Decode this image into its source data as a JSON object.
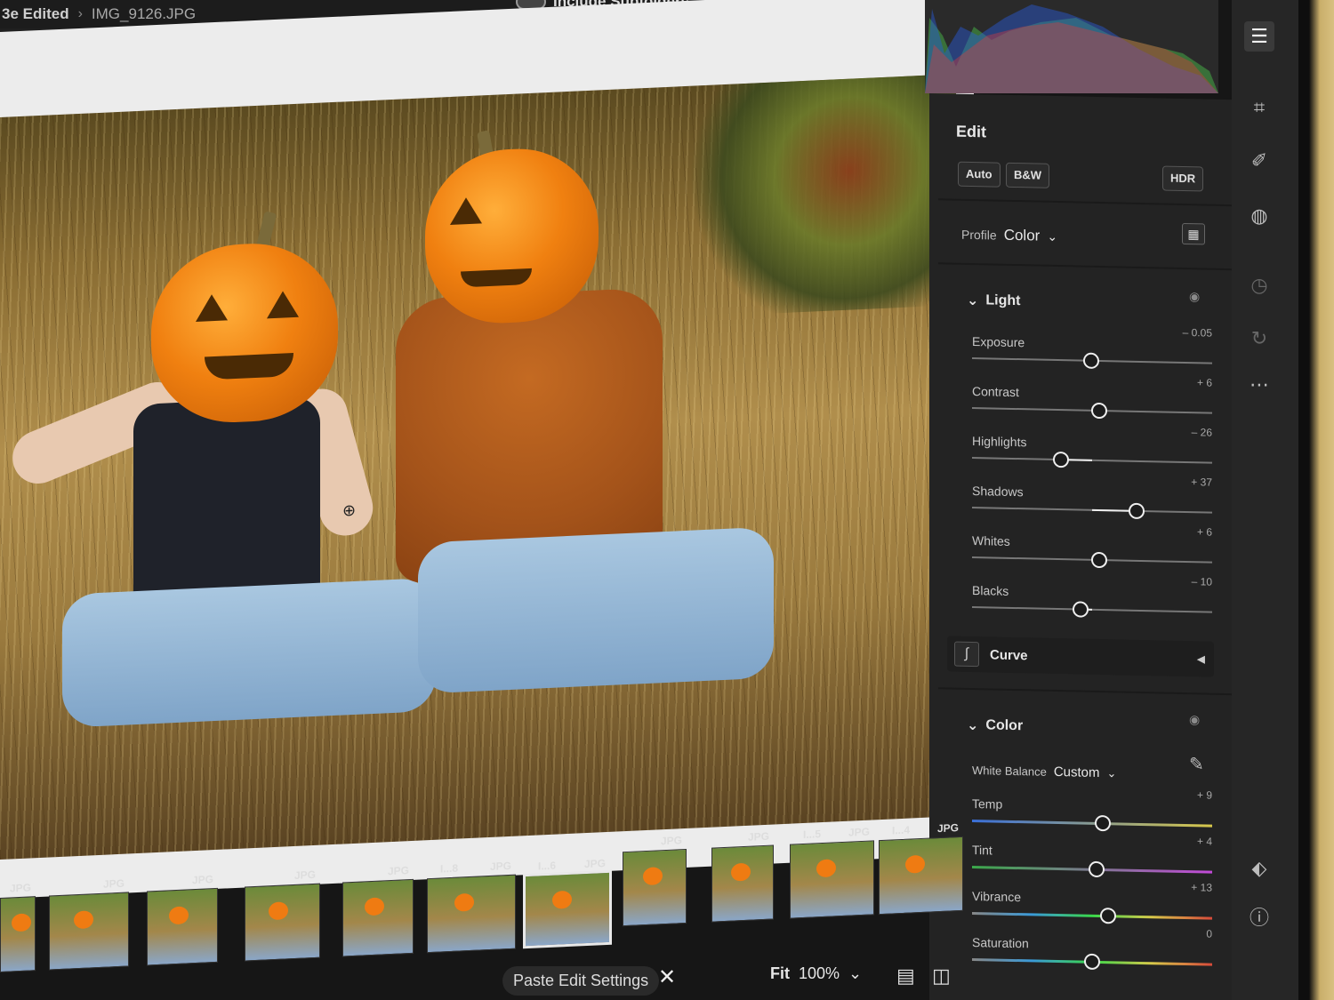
{
  "breadcrumb": {
    "folder": "3e Edited",
    "file": "IMG_9126.JPG"
  },
  "top": {
    "subfolders_label": "Include Subfolders"
  },
  "edit_panel": {
    "title": "Edit",
    "buttons": {
      "auto": "Auto",
      "bw": "B&W",
      "hdr": "HDR"
    },
    "profile": {
      "label": "Profile",
      "value": "Color"
    },
    "light": {
      "title": "Light",
      "sliders": [
        {
          "label": "Exposure",
          "value_text": "– 0.05",
          "value": -0.05,
          "min": -5,
          "max": 5
        },
        {
          "label": "Contrast",
          "value_text": "+ 6",
          "value": 6,
          "min": -100,
          "max": 100
        },
        {
          "label": "Highlights",
          "value_text": "– 26",
          "value": -26,
          "min": -100,
          "max": 100
        },
        {
          "label": "Shadows",
          "value_text": "+ 37",
          "value": 37,
          "min": -100,
          "max": 100
        },
        {
          "label": "Whites",
          "value_text": "+ 6",
          "value": 6,
          "min": -100,
          "max": 100
        },
        {
          "label": "Blacks",
          "value_text": "– 10",
          "value": -10,
          "min": -100,
          "max": 100
        }
      ]
    },
    "curve": {
      "label": "Curve"
    },
    "color": {
      "title": "Color",
      "white_balance": {
        "label": "White Balance",
        "value": "Custom"
      },
      "sliders": [
        {
          "label": "Temp",
          "value_text": "+ 9",
          "value": 9,
          "min": -100,
          "max": 100
        },
        {
          "label": "Tint",
          "value_text": "+ 4",
          "value": 4,
          "min": -100,
          "max": 100
        },
        {
          "label": "Vibrance",
          "value_text": "+ 13",
          "value": 13,
          "min": -100,
          "max": 100
        },
        {
          "label": "Saturation",
          "value_text": "0",
          "value": 0,
          "min": -100,
          "max": 100
        }
      ]
    }
  },
  "filmstrip": {
    "thumbs": [
      {
        "num": "",
        "badge": "JPG"
      },
      {
        "num": "",
        "badge": "JPG"
      },
      {
        "num": "",
        "badge": "JPG"
      },
      {
        "num": "",
        "badge": "JPG"
      },
      {
        "num": "",
        "badge": "JPG"
      },
      {
        "num": "I...8",
        "badge": "JPG"
      },
      {
        "num": "I...6",
        "badge": "JPG",
        "selected": true
      },
      {
        "num": "",
        "badge": "JPG"
      },
      {
        "num": "",
        "badge": "JPG"
      },
      {
        "num": "I...5",
        "badge": "JPG"
      },
      {
        "num": "I...4",
        "badge": "JPG"
      }
    ]
  },
  "bottom": {
    "fit": "Fit",
    "zoom": "100%",
    "paste": "Paste Edit Settings"
  },
  "colors": {
    "panel_bg": "#232323",
    "accent_pumpkin": "#f08010",
    "rail_bg": "#262626"
  }
}
